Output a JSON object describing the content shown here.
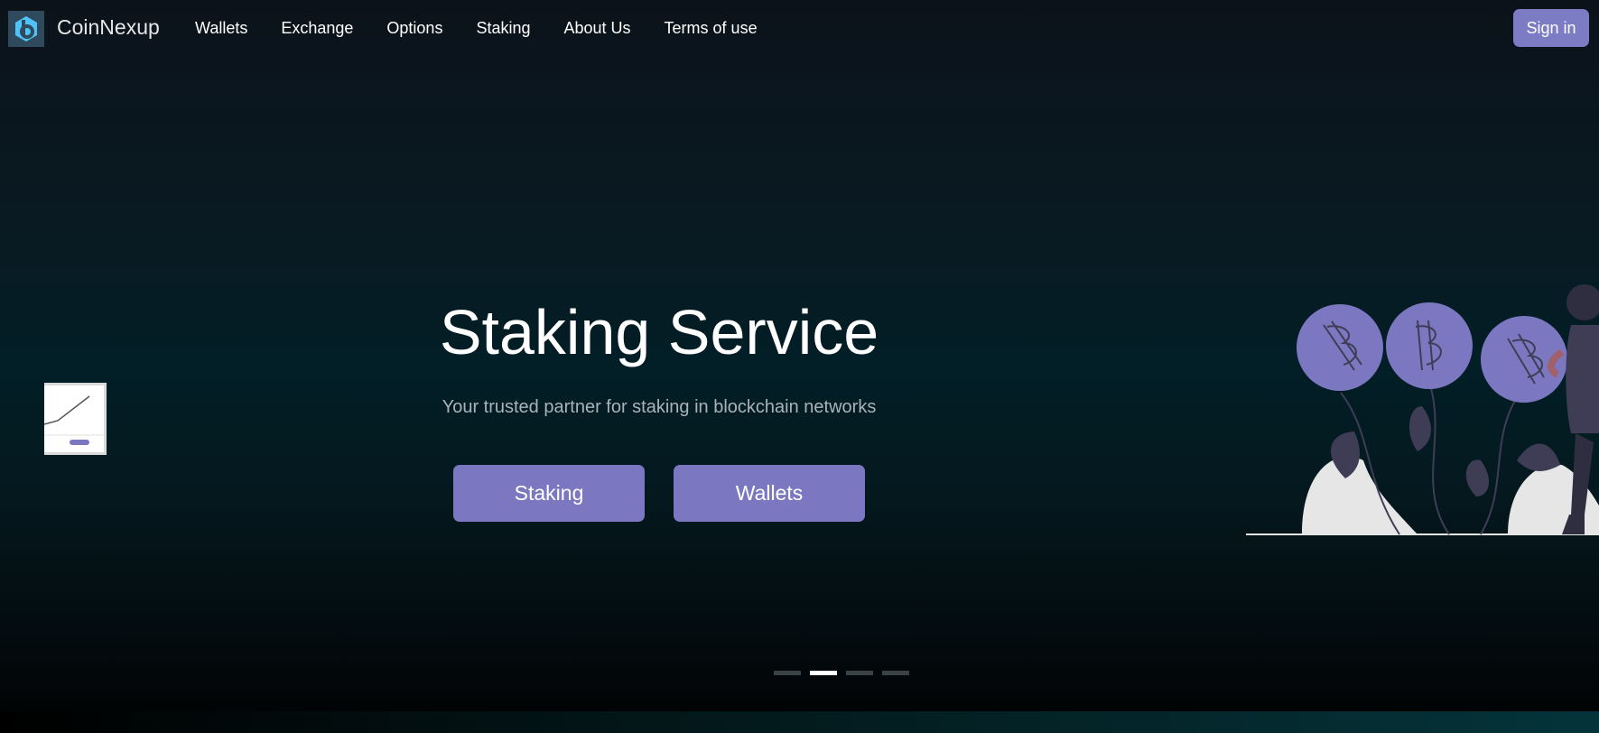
{
  "brand": {
    "name": "CoinNexup",
    "logo_color": "#2f4a5c",
    "logo_accent": "#4fc3f7"
  },
  "nav": {
    "links": [
      {
        "label": "Wallets"
      },
      {
        "label": "Exchange"
      },
      {
        "label": "Options"
      },
      {
        "label": "Staking"
      },
      {
        "label": "About Us"
      },
      {
        "label": "Terms of use"
      }
    ],
    "signin_label": "Sign in"
  },
  "hero": {
    "title": "Staking Service",
    "subtitle": "Your trusted partner for staking in blockchain networks",
    "buttons": {
      "staking_label": "Staking",
      "wallets_label": "Wallets"
    },
    "accent_color": "#7b78c1"
  },
  "carousel": {
    "slide_count": 4,
    "active_index": 1
  },
  "illustration": {
    "icons": [
      "bitcoin-coin-icon",
      "bitcoin-coin-icon",
      "bitcoin-coin-icon"
    ],
    "coin_color": "#7b78c1"
  }
}
